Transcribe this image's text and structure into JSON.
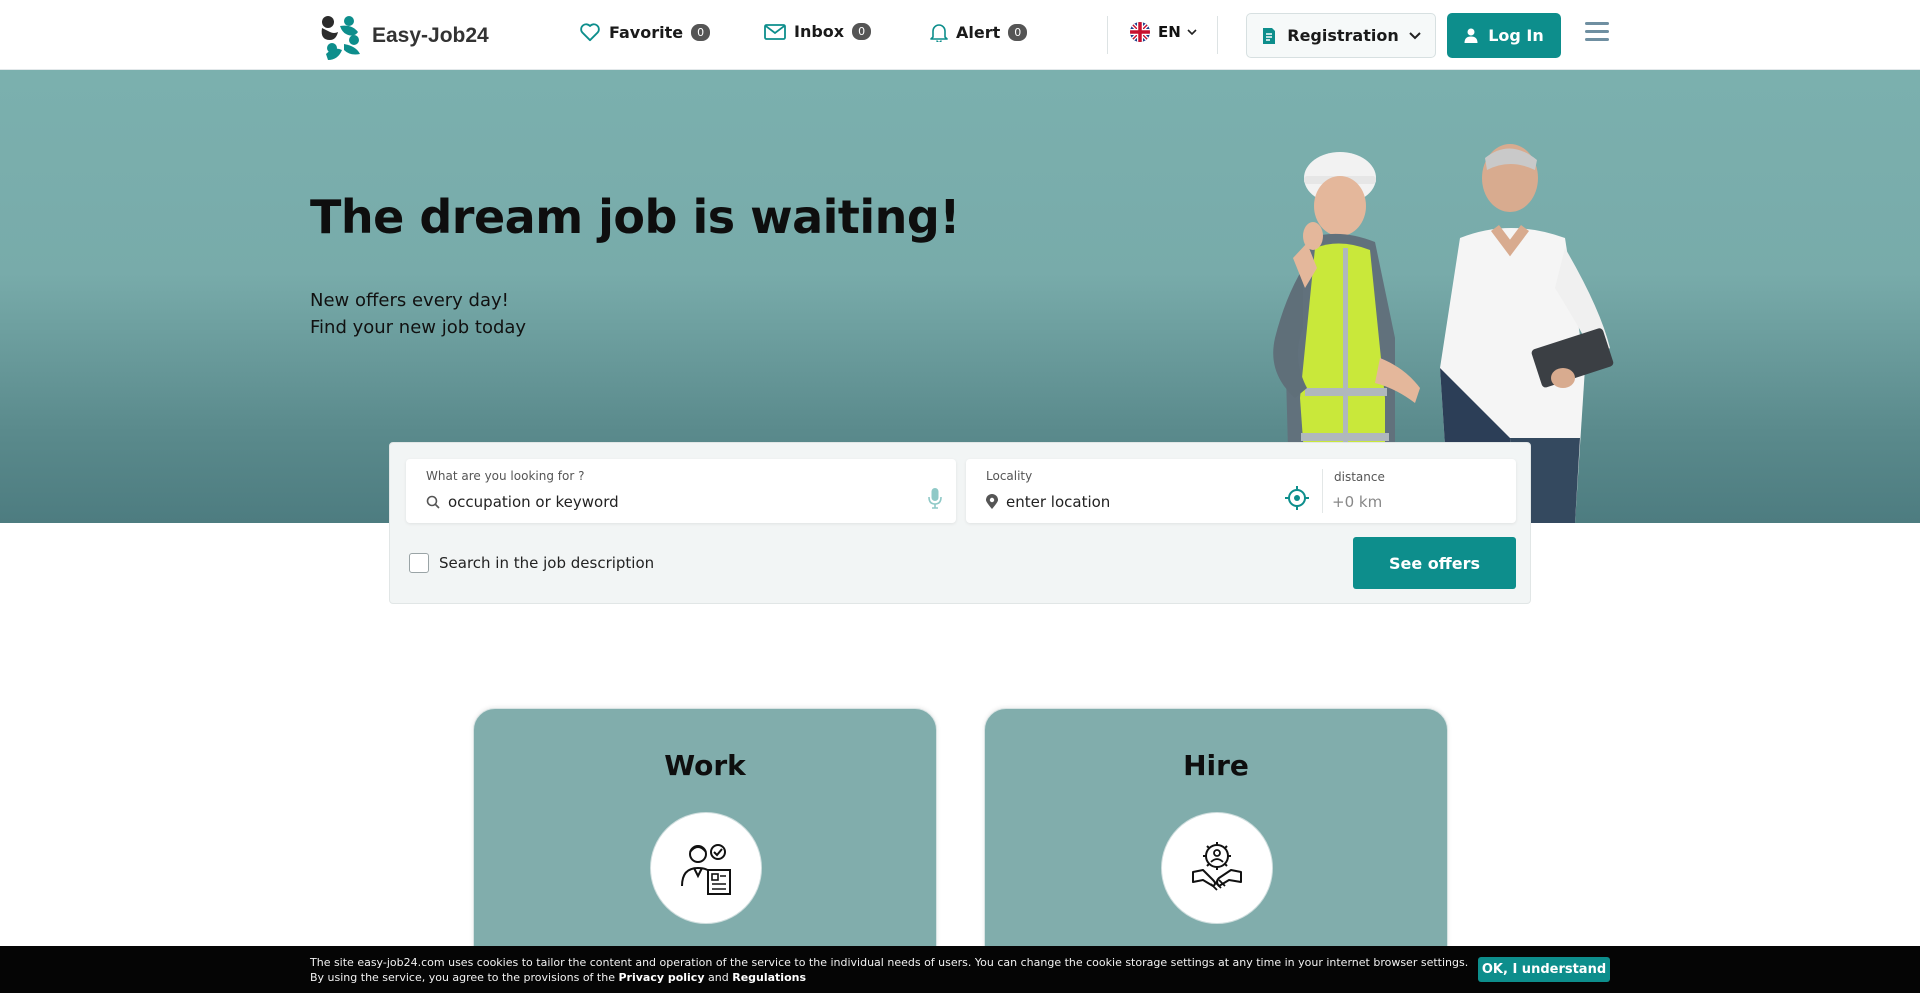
{
  "brand": {
    "name": "Easy-Job24",
    "accent_color": "#0d8e8c"
  },
  "nav": {
    "favorite": {
      "label": "Favorite",
      "count": "0",
      "icon": "heart-icon"
    },
    "inbox": {
      "label": "Inbox",
      "count": "0",
      "icon": "envelope-icon"
    },
    "alert": {
      "label": "Alert",
      "count": "0",
      "icon": "bell-icon"
    },
    "language": {
      "code": "EN",
      "icon": "uk-flag-icon"
    },
    "registration_label": "Registration",
    "login_label": "Log In"
  },
  "hero": {
    "title": "The dream job is waiting!",
    "subtitle_line1": "New offers every day!",
    "subtitle_line2": "Find your new job today",
    "background_color": "#7bb0ae"
  },
  "search": {
    "what_label": "What are you looking for ?",
    "what_placeholder": "occupation or keyword",
    "locality_label": "Locality",
    "locality_placeholder": "enter location",
    "distance_label": "distance",
    "distance_value": "+0 km",
    "description_checkbox_label": "Search in the job description",
    "description_checked": false,
    "submit_label": "See offers"
  },
  "cards": [
    {
      "title": "Work",
      "icon": "worker-resume-icon"
    },
    {
      "title": "Hire",
      "icon": "handshake-team-icon"
    }
  ],
  "cookie": {
    "text_part1": "The site easy-job24.com uses cookies to tailor the content and operation of the service to the individual needs of users. You can change the cookie storage settings at any time in your internet browser settings. By using the service, you agree to the provisions of the ",
    "privacy_link": "Privacy policy",
    "and_text": " and ",
    "regulations_link": "Regulations",
    "accept_label": "OK, I understand"
  }
}
